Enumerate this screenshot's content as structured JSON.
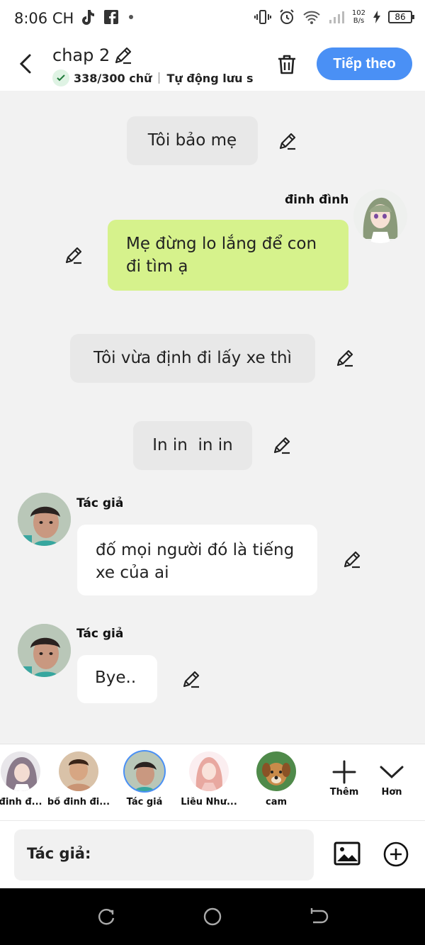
{
  "status": {
    "time": "8:06 CH",
    "speed_top": "102",
    "speed_bottom": "B/s",
    "battery": "86"
  },
  "header": {
    "title": "chap 2",
    "word_count": "338/300 chữ",
    "autosave": "Tự động lưu s",
    "next_label": "Tiếp theo"
  },
  "messages": {
    "m1": "Tôi bảo mẹ",
    "m2_name": "đinh đình",
    "m2": "Mẹ đừng lo lắng để con đi tìm ạ",
    "m3": "Tôi vừa định đi lấy xe thì",
    "m4": "In in  in in",
    "m5_name": "Tác giả",
    "m5": "đố mọi người đó là tiếng xe của ai",
    "m6_name": "Tác giả",
    "m6": "Bye.."
  },
  "characters": [
    {
      "label": "đinh đ..."
    },
    {
      "label": "bố đinh đi..."
    },
    {
      "label": "Tác giả"
    },
    {
      "label": "Liễu Như..."
    },
    {
      "label": "cam"
    }
  ],
  "char_actions": {
    "add": "Thêm",
    "more": "Hơn"
  },
  "input": {
    "speaker": "Tác giả:"
  },
  "colors": {
    "accent": "#4a90f5",
    "green_bubble": "#d6f28c"
  }
}
